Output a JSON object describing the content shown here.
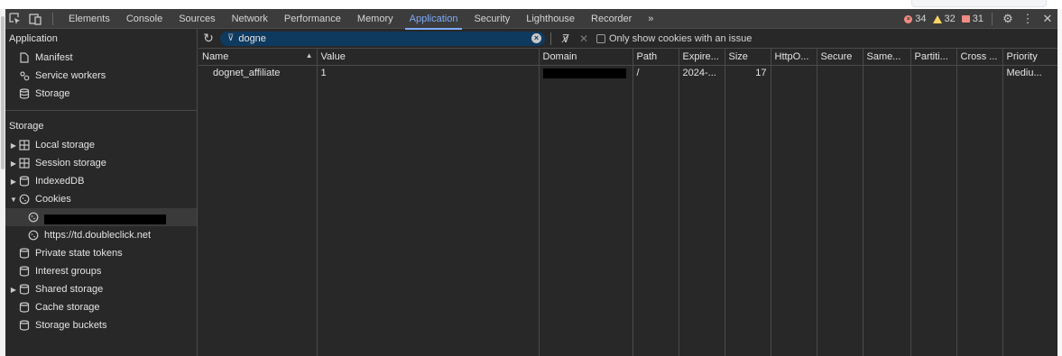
{
  "tabs": {
    "elements": "Elements",
    "console": "Console",
    "sources": "Sources",
    "network": "Network",
    "performance": "Performance",
    "memory": "Memory",
    "application": "Application",
    "security": "Security",
    "lighthouse": "Lighthouse",
    "recorder": "Recorder",
    "more": "»"
  },
  "status": {
    "errors": "34",
    "warnings": "32",
    "issues": "31"
  },
  "sidebar": {
    "application_header": "Application",
    "app_items": [
      {
        "label": "Manifest",
        "icon": "document-icon"
      },
      {
        "label": "Service workers",
        "icon": "gears-icon"
      },
      {
        "label": "Storage",
        "icon": "database-icon"
      }
    ],
    "storage_header": "Storage",
    "local_storage": "Local storage",
    "session_storage": "Session storage",
    "indexeddb": "IndexedDB",
    "cookies": "Cookies",
    "cookie_origin_2": "https://td.doubleclick.net",
    "private_state_tokens": "Private state tokens",
    "interest_groups": "Interest groups",
    "shared_storage": "Shared storage",
    "cache_storage": "Cache storage",
    "storage_buckets": "Storage buckets"
  },
  "toolbar": {
    "filter_value": "dogne",
    "only_issues_label": "Only show cookies with an issue"
  },
  "table": {
    "headers": {
      "name": "Name",
      "value": "Value",
      "domain": "Domain",
      "path": "Path",
      "expires": "Expire...",
      "size": "Size",
      "httponly": "HttpO...",
      "secure": "Secure",
      "samesite": "Same...",
      "partition": "Partiti...",
      "crosssite": "Cross ...",
      "priority": "Priority"
    },
    "row": {
      "name": "dognet_affiliate",
      "value": "1",
      "path": "/",
      "expires": "2024-...",
      "size": "17",
      "priority": "Mediu..."
    }
  },
  "colors": {
    "accent": "#7cacf8",
    "panel_bg": "#282828",
    "tabbar_bg": "#3c3c3c",
    "filter_bg": "#0f3a5f",
    "error": "#f28b82",
    "warning": "#fdd663"
  }
}
